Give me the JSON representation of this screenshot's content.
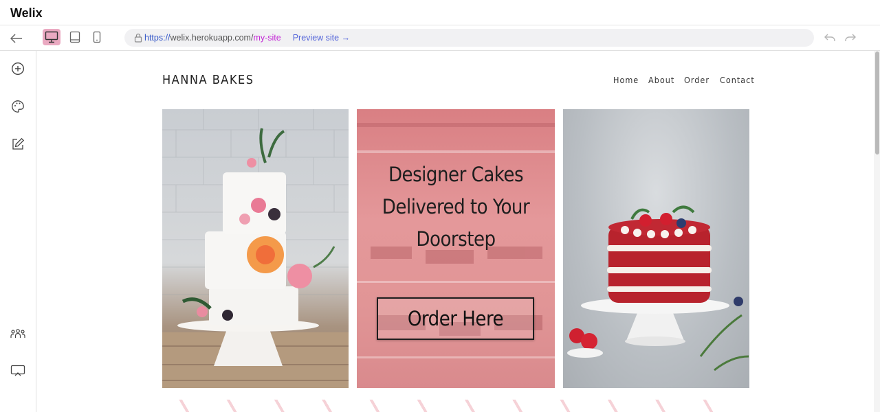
{
  "app": {
    "title": "Welix"
  },
  "toolbar": {
    "url_protocol": "https://",
    "url_host": "welix.herokuapp.com/",
    "url_path": "my-site",
    "preview_label": "Preview site →",
    "devices": [
      "desktop",
      "tablet",
      "mobile"
    ],
    "active_device": "desktop"
  },
  "sidebar": {
    "items": [
      {
        "icon": "add-icon"
      },
      {
        "icon": "palette-icon"
      },
      {
        "icon": "edit-icon"
      },
      {
        "icon": "team-icon"
      },
      {
        "icon": "present-icon"
      }
    ]
  },
  "site": {
    "name": "HANNA BAKES",
    "nav": [
      "Home",
      "About",
      "Order",
      "Contact"
    ],
    "hero_lines": [
      "Designer Cakes",
      "Delivered to Your",
      "Doorstep"
    ],
    "cta_label": "Order Here"
  },
  "colors": {
    "active_device_bg": "#eaa9c1",
    "url_path": "#c42bd6",
    "preview_link": "#5566d9",
    "hero_panel": "#e4989a"
  }
}
